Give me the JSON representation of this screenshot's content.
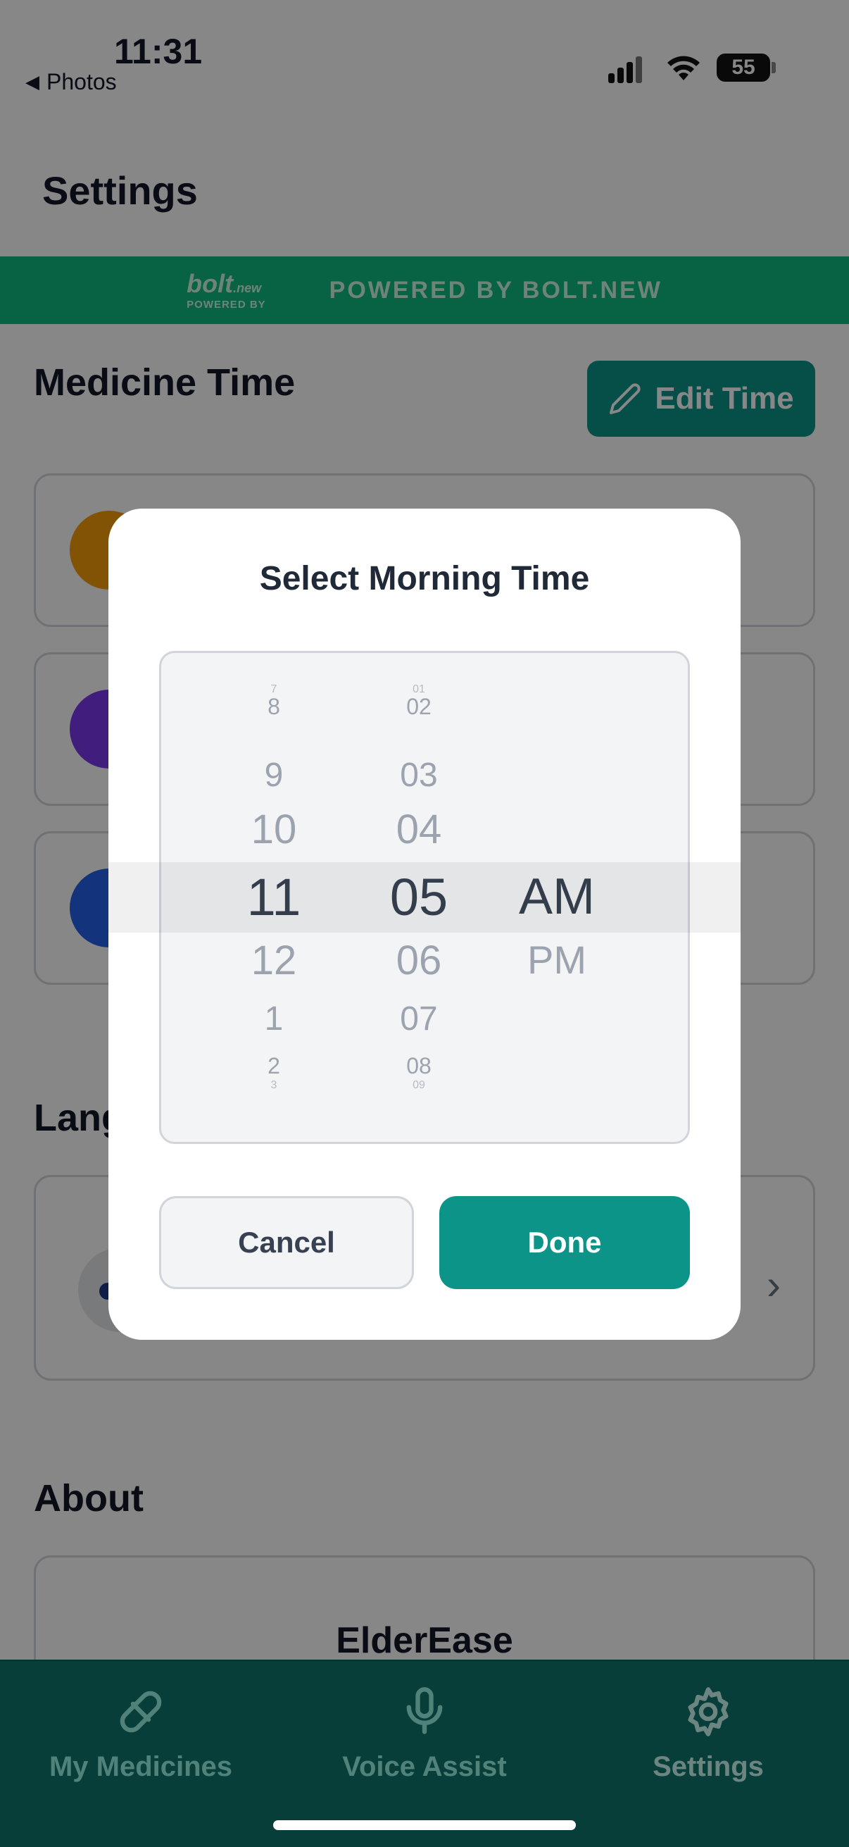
{
  "status_bar": {
    "time": "11:31",
    "back_label": "Photos",
    "battery": "55"
  },
  "header": {
    "title": "Settings"
  },
  "banner": {
    "logo_text": "bolt",
    "logo_suffix": ".new",
    "logo_sub": "POWERED BY",
    "text": "POWERED BY BOLT.NEW"
  },
  "medicine_section": {
    "title": "Medicine Time",
    "edit_button": "Edit Time",
    "avatar_colors": [
      "#f59e0b",
      "#7c3aed",
      "#2563eb"
    ]
  },
  "language_section": {
    "title": "Language"
  },
  "about_section": {
    "title": "About",
    "app_name": "ElderEase"
  },
  "modal": {
    "title": "Select Morning Time",
    "hours": [
      "7",
      "8",
      "9",
      "10",
      "11",
      "12",
      "1",
      "2",
      "3"
    ],
    "minutes": [
      "01",
      "02",
      "03",
      "04",
      "05",
      "06",
      "07",
      "08",
      "09"
    ],
    "periods": [
      "AM",
      "PM"
    ],
    "selected": {
      "hour": "11",
      "minute": "05",
      "period": "AM"
    },
    "cancel_label": "Cancel",
    "done_label": "Done"
  },
  "tabs": [
    {
      "label": "My Medicines",
      "icon": "pill-icon"
    },
    {
      "label": "Voice Assist",
      "icon": "microphone-icon"
    },
    {
      "label": "Settings",
      "icon": "gear-icon"
    }
  ],
  "colors": {
    "accent": "#0d9488",
    "banner": "#10b981",
    "tabbar": "#0f766e"
  }
}
